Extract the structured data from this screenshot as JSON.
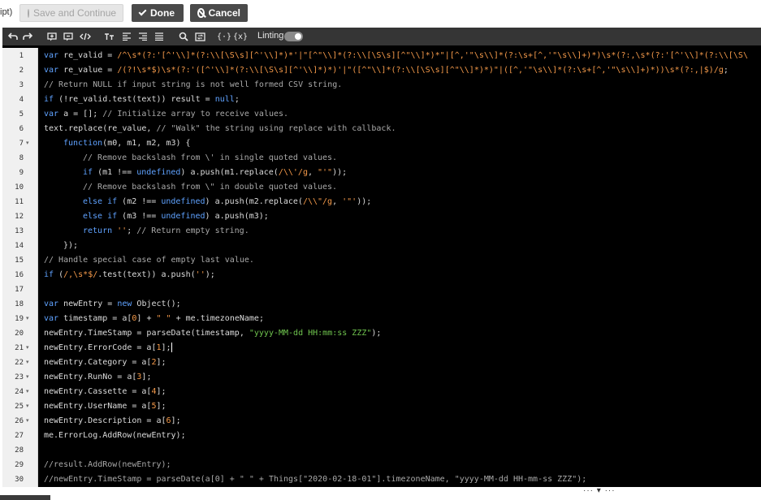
{
  "topbar": {
    "crumb": "ipt)",
    "save_label": "Save and Continue",
    "done_label": "Done",
    "cancel_label": "Cancel"
  },
  "toolbar": {
    "linting_label": "Linting",
    "linting_on": true,
    "tools": [
      "undo-icon",
      "redo-icon",
      "comment-icon",
      "uncomment-icon",
      "code-icon",
      "text-size-icon",
      "align-left-icon",
      "align-right-icon",
      "justify-icon",
      "search-icon",
      "replace-icon",
      "braces-icon",
      "braces-var-icon"
    ]
  },
  "colors": {
    "keyword": "#5fa2ff",
    "string": "#f59a4a",
    "string_alt": "#6fc44e",
    "comment": "#a9a9a9",
    "text": "#dcdcdc",
    "background": "#000000"
  },
  "resize_handle": "··· ▾ ···",
  "lines": [
    {
      "n": "1",
      "fold": false,
      "indent": 0,
      "segs": [
        [
          "kw",
          "var "
        ],
        [
          "",
          "re_valid = "
        ],
        [
          "str",
          "/^\\s*(?:'[^'\\\\]*(?:\\\\[\\S\\s][^'\\\\]*)*'|\"[^\"\\\\]*(?:\\\\[\\S\\s][^\"\\\\]*)*\"|[^,'\"\\s\\\\]*(?:\\s+[^,'\"\\s\\\\]+)*)\\s*(?:,\\s*(?:'[^'\\\\]*(?:\\\\[\\S\\"
        ]
      ]
    },
    {
      "n": "2",
      "fold": false,
      "indent": 0,
      "segs": [
        [
          "kw",
          "var "
        ],
        [
          "",
          "re_value = "
        ],
        [
          "str",
          "/(?!\\s*$)\\s*(?:'([^'\\\\]*(?:\\\\[\\S\\s][^'\\\\]*)*)'|\"([^\"\\\\]*(?:\\\\[\\S\\s][^\"\\\\]*)*)\"|([^,'\"\\s\\\\]*(?:\\s+[^,'\"\\s\\\\]+)*))\\s*(?:,|$)/g"
        ],
        [
          "",
          ";"
        ]
      ]
    },
    {
      "n": "3",
      "fold": false,
      "indent": 0,
      "segs": [
        [
          "cm",
          "// Return NULL if input string is not well formed CSV string."
        ]
      ]
    },
    {
      "n": "4",
      "fold": false,
      "indent": 0,
      "segs": [
        [
          "kw",
          "if "
        ],
        [
          "",
          "(!re_valid.test(text)) result = "
        ],
        [
          "kw",
          "null"
        ],
        [
          "",
          ";"
        ]
      ]
    },
    {
      "n": "5",
      "fold": false,
      "indent": 0,
      "segs": [
        [
          "kw",
          "var "
        ],
        [
          "",
          "a = []; "
        ],
        [
          "cm",
          "// Initialize array to receive values."
        ]
      ]
    },
    {
      "n": "6",
      "fold": false,
      "indent": 0,
      "segs": [
        [
          "",
          "text.replace(re_value, "
        ],
        [
          "cm",
          "// \"Walk\" the string using replace with callback."
        ]
      ]
    },
    {
      "n": "7",
      "fold": true,
      "indent": 1,
      "segs": [
        [
          "kw",
          "function"
        ],
        [
          "",
          "(m0, m1, m2, m3) {"
        ]
      ]
    },
    {
      "n": "8",
      "fold": false,
      "indent": 2,
      "segs": [
        [
          "cm",
          "// Remove backslash from \\' in single quoted values."
        ]
      ]
    },
    {
      "n": "9",
      "fold": false,
      "indent": 2,
      "segs": [
        [
          "kw",
          "if "
        ],
        [
          "",
          "(m1 !== "
        ],
        [
          "kw",
          "undefined"
        ],
        [
          "",
          ") a.push(m1.replace("
        ],
        [
          "str",
          "/\\\\'/g"
        ],
        [
          "",
          ", "
        ],
        [
          "str",
          "\"'\""
        ],
        [
          "",
          "));"
        ]
      ]
    },
    {
      "n": "10",
      "fold": false,
      "indent": 2,
      "segs": [
        [
          "cm",
          "// Remove backslash from \\\" in double quoted values."
        ]
      ]
    },
    {
      "n": "11",
      "fold": false,
      "indent": 2,
      "segs": [
        [
          "kw",
          "else if "
        ],
        [
          "",
          "(m2 !== "
        ],
        [
          "kw",
          "undefined"
        ],
        [
          "",
          ") a.push(m2.replace("
        ],
        [
          "str",
          "/\\\\\"/g"
        ],
        [
          "",
          ", "
        ],
        [
          "str",
          "'\"'"
        ],
        [
          "",
          "));"
        ]
      ]
    },
    {
      "n": "12",
      "fold": false,
      "indent": 2,
      "segs": [
        [
          "kw",
          "else if "
        ],
        [
          "",
          "(m3 !== "
        ],
        [
          "kw",
          "undefined"
        ],
        [
          "",
          ") a.push(m3);"
        ]
      ]
    },
    {
      "n": "13",
      "fold": false,
      "indent": 2,
      "segs": [
        [
          "kw",
          "return "
        ],
        [
          "str",
          "''"
        ],
        [
          "",
          "; "
        ],
        [
          "cm",
          "// Return empty string."
        ]
      ]
    },
    {
      "n": "14",
      "fold": false,
      "indent": 1,
      "segs": [
        [
          "",
          "});"
        ]
      ]
    },
    {
      "n": "15",
      "fold": false,
      "indent": 0,
      "segs": [
        [
          "cm",
          "// Handle special case of empty last value."
        ]
      ]
    },
    {
      "n": "16",
      "fold": false,
      "indent": 0,
      "segs": [
        [
          "kw",
          "if "
        ],
        [
          "",
          "("
        ],
        [
          "str",
          "/,\\s*$/"
        ],
        [
          "",
          ".test(text)) a.push("
        ],
        [
          "str",
          "''"
        ],
        [
          "",
          ");"
        ]
      ]
    },
    {
      "n": "17",
      "fold": false,
      "indent": 0,
      "segs": []
    },
    {
      "n": "18",
      "fold": false,
      "indent": 0,
      "segs": [
        [
          "kw",
          "var "
        ],
        [
          "",
          "newEntry = "
        ],
        [
          "kw",
          "new "
        ],
        [
          "",
          "Object();"
        ]
      ]
    },
    {
      "n": "19",
      "fold": true,
      "indent": 0,
      "segs": [
        [
          "kw",
          "var "
        ],
        [
          "",
          "timestamp = a["
        ],
        [
          "num",
          "0"
        ],
        [
          "",
          "] + "
        ],
        [
          "str",
          "\" \""
        ],
        [
          "",
          " + me.timezoneName;"
        ]
      ]
    },
    {
      "n": "20",
      "fold": false,
      "indent": 0,
      "segs": [
        [
          "",
          "newEntry.TimeStamp = parseDate(timestamp, "
        ],
        [
          "str2",
          "\"yyyy-MM-dd HH:mm:ss ZZZ\""
        ],
        [
          "",
          ");"
        ]
      ]
    },
    {
      "n": "21",
      "fold": true,
      "indent": 0,
      "cursor": true,
      "segs": [
        [
          "",
          "newEntry.ErrorCode = a["
        ],
        [
          "num",
          "1"
        ],
        [
          "",
          "];"
        ]
      ]
    },
    {
      "n": "22",
      "fold": true,
      "indent": 0,
      "segs": [
        [
          "",
          "newEntry.Category = a["
        ],
        [
          "num",
          "2"
        ],
        [
          "",
          "];"
        ]
      ]
    },
    {
      "n": "23",
      "fold": true,
      "indent": 0,
      "segs": [
        [
          "",
          "newEntry.RunNo = a["
        ],
        [
          "num",
          "3"
        ],
        [
          "",
          "];"
        ]
      ]
    },
    {
      "n": "24",
      "fold": true,
      "indent": 0,
      "segs": [
        [
          "",
          "newEntry.Cassette = a["
        ],
        [
          "num",
          "4"
        ],
        [
          "",
          "];"
        ]
      ]
    },
    {
      "n": "25",
      "fold": true,
      "indent": 0,
      "segs": [
        [
          "",
          "newEntry.UserName = a["
        ],
        [
          "num",
          "5"
        ],
        [
          "",
          "];"
        ]
      ]
    },
    {
      "n": "26",
      "fold": true,
      "indent": 0,
      "segs": [
        [
          "",
          "newEntry.Description = a["
        ],
        [
          "num",
          "6"
        ],
        [
          "",
          "];"
        ]
      ]
    },
    {
      "n": "27",
      "fold": false,
      "indent": 0,
      "segs": [
        [
          "",
          "me.ErrorLog.AddRow(newEntry);"
        ]
      ]
    },
    {
      "n": "28",
      "fold": false,
      "indent": 0,
      "segs": []
    },
    {
      "n": "29",
      "fold": false,
      "indent": 0,
      "segs": [
        [
          "cm",
          "//result.AddRow(newEntry);"
        ]
      ]
    },
    {
      "n": "30",
      "fold": false,
      "indent": 0,
      "segs": [
        [
          "cm",
          "//newEntry.TimeStamp = parseDate(a[0] + \" \" + Things[\"2020-02-18-01\"].timezoneName, \"yyyy-MM-dd HH-mm-ss ZZZ\");"
        ]
      ]
    }
  ]
}
